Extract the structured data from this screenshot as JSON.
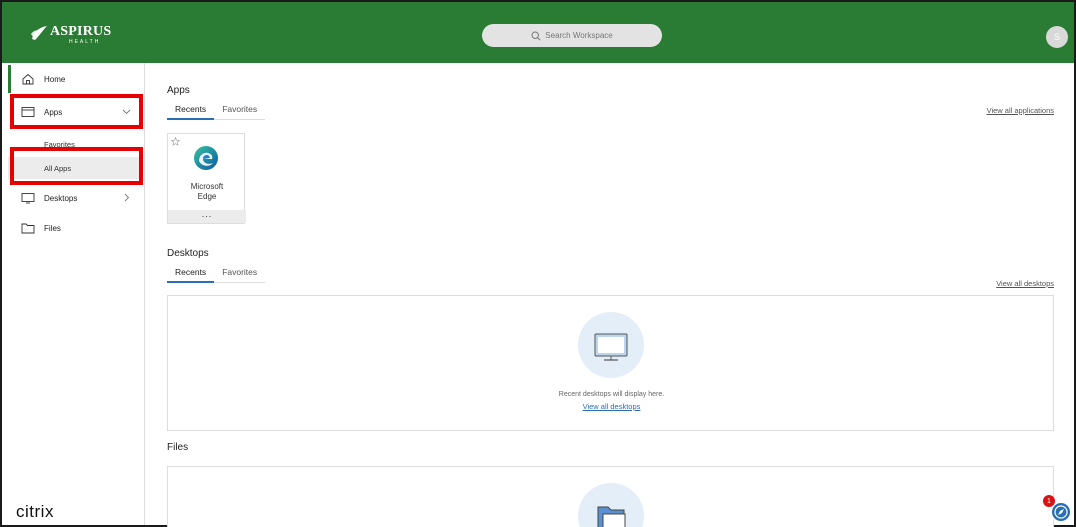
{
  "header": {
    "brand": "ASPIRUS",
    "brand_sub": "HEALTH",
    "search_placeholder": "Search Workspace",
    "avatar_initial": "S"
  },
  "sidebar": {
    "home": "Home",
    "apps": "Apps",
    "apps_sub": [
      "Favorites",
      "All Apps"
    ],
    "desktops": "Desktops",
    "files": "Files",
    "footer_logo": "citrix"
  },
  "apps_section": {
    "title": "Apps",
    "tabs": [
      "Recents",
      "Favorites"
    ],
    "view_all": "View all applications",
    "items": [
      {
        "name_line1": "Microsoft",
        "name_line2": "Edge",
        "more": "..."
      }
    ]
  },
  "desktops_section": {
    "title": "Desktops",
    "tabs": [
      "Recents",
      "Favorites"
    ],
    "view_all": "View all desktops",
    "empty_text": "Recent desktops will display here.",
    "empty_link": "View all desktops"
  },
  "files_section": {
    "title": "Files"
  },
  "notification_count": "1",
  "colors": {
    "header_green": "#2a7b34",
    "highlight_red": "#e60000",
    "link_blue": "#2a6fb3"
  }
}
